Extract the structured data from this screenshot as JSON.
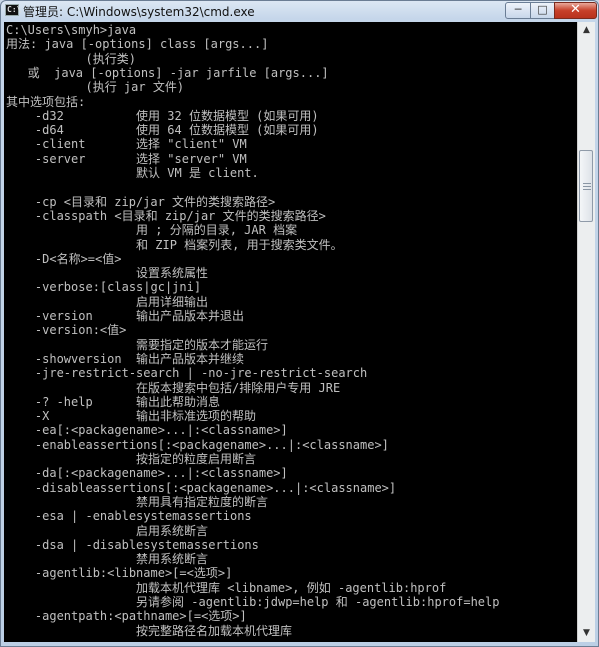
{
  "window": {
    "title": "管理员: C:\\Windows\\system32\\cmd.exe",
    "app_icon_text": "C:\\",
    "controls": {
      "minimize": "─",
      "maximize": "□",
      "close": "✕"
    }
  },
  "console": {
    "lines": [
      "C:\\Users\\smyh>java",
      "用法: java [-options] class [args...]",
      "           (执行类)",
      "   或  java [-options] -jar jarfile [args...]",
      "           (执行 jar 文件)",
      "其中选项包括:",
      "    -d32          使用 32 位数据模型 (如果可用)",
      "    -d64          使用 64 位数据模型 (如果可用)",
      "    -client       选择 \"client\" VM",
      "    -server       选择 \"server\" VM",
      "                  默认 VM 是 client.",
      "",
      "    -cp <目录和 zip/jar 文件的类搜索路径>",
      "    -classpath <目录和 zip/jar 文件的类搜索路径>",
      "                  用 ; 分隔的目录, JAR 档案",
      "                  和 ZIP 档案列表, 用于搜索类文件。",
      "    -D<名称>=<值>",
      "                  设置系统属性",
      "    -verbose:[class|gc|jni]",
      "                  启用详细输出",
      "    -version      输出产品版本并退出",
      "    -version:<值>",
      "                  需要指定的版本才能运行",
      "    -showversion  输出产品版本并继续",
      "    -jre-restrict-search | -no-jre-restrict-search",
      "                  在版本搜索中包括/排除用户专用 JRE",
      "    -? -help      输出此帮助消息",
      "    -X            输出非标准选项的帮助",
      "    -ea[:<packagename>...|:<classname>]",
      "    -enableassertions[:<packagename>...|:<classname>]",
      "                  按指定的粒度启用断言",
      "    -da[:<packagename>...|:<classname>]",
      "    -disableassertions[:<packagename>...|:<classname>]",
      "                  禁用具有指定粒度的断言",
      "    -esa | -enablesystemassertions",
      "                  启用系统断言",
      "    -dsa | -disablesystemassertions",
      "                  禁用系统断言",
      "    -agentlib:<libname>[=<选项>]",
      "                  加载本机代理库 <libname>, 例如 -agentlib:hprof",
      "                  另请参阅 -agentlib:jdwp=help 和 -agentlib:hprof=help",
      "    -agentpath:<pathname>[=<选项>]",
      "                  按完整路径名加载本机代理库"
    ]
  },
  "scrollbar": {
    "up_arrow": "▲",
    "down_arrow": "▼"
  }
}
